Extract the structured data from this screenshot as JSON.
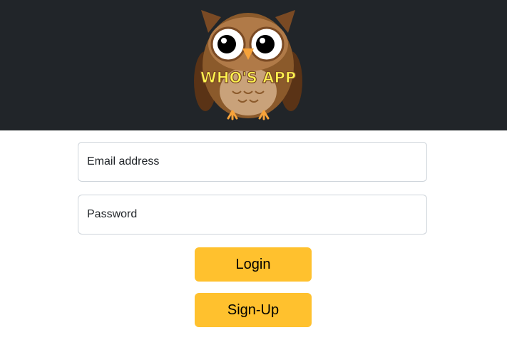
{
  "header": {
    "logo_text": "WHO'S APP",
    "logo_icon": "owl-icon",
    "background": "#212529"
  },
  "form": {
    "email_placeholder": "Email address",
    "email_value": "",
    "password_placeholder": "Password",
    "password_value": ""
  },
  "buttons": {
    "login_label": "Login",
    "signup_label": "Sign-Up",
    "color": "#ffc12e"
  }
}
